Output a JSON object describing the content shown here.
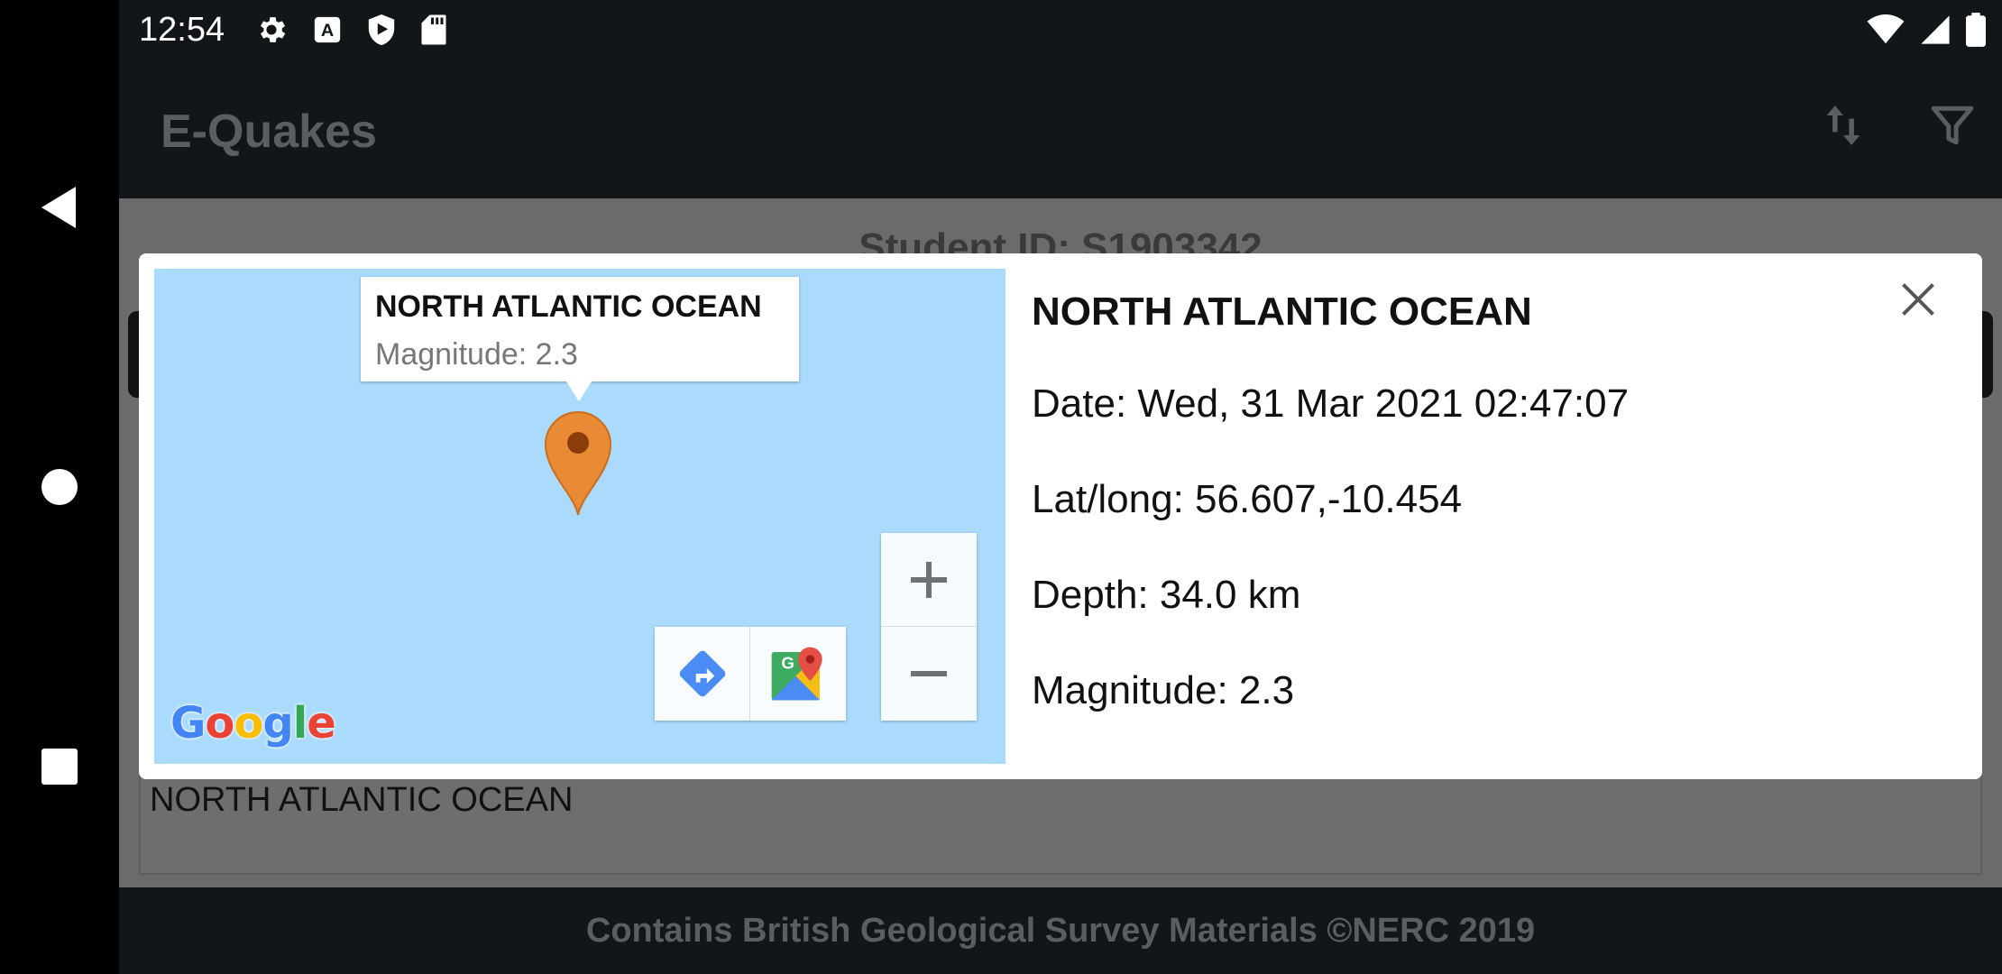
{
  "status_bar": {
    "time": "12:54",
    "left_icons": [
      "settings-icon",
      "accessibility-icon",
      "shield-play-icon",
      "sd-card-icon"
    ],
    "right_icons": [
      "wifi-icon",
      "signal-icon",
      "battery-icon"
    ]
  },
  "app_bar": {
    "title": "E-Quakes",
    "actions": [
      "sort-icon",
      "filter-icon"
    ]
  },
  "background": {
    "student_id": "Student ID: S1903342",
    "card_label": "NORTH ATLANTIC OCEAN"
  },
  "footer": {
    "text": "Contains British Geological Survey Materials ©NERC 2019"
  },
  "dialog": {
    "map": {
      "info_title": "NORTH ATLANTIC OCEAN",
      "info_snippet": "Magnitude: 2.3",
      "zoom_in": "+",
      "zoom_out": "−",
      "logo": "Google"
    },
    "title": "NORTH ATLANTIC OCEAN",
    "date": "Date: Wed, 31 Mar 2021 02:47:07",
    "latlong": "Lat/long: 56.607,-10.454",
    "depth": "Depth: 34.0 km",
    "magnitude": "Magnitude: 2.3"
  },
  "colors": {
    "marker": "#e98b34",
    "map_water": "#aadafc",
    "directions_blue": "#4285f4"
  }
}
